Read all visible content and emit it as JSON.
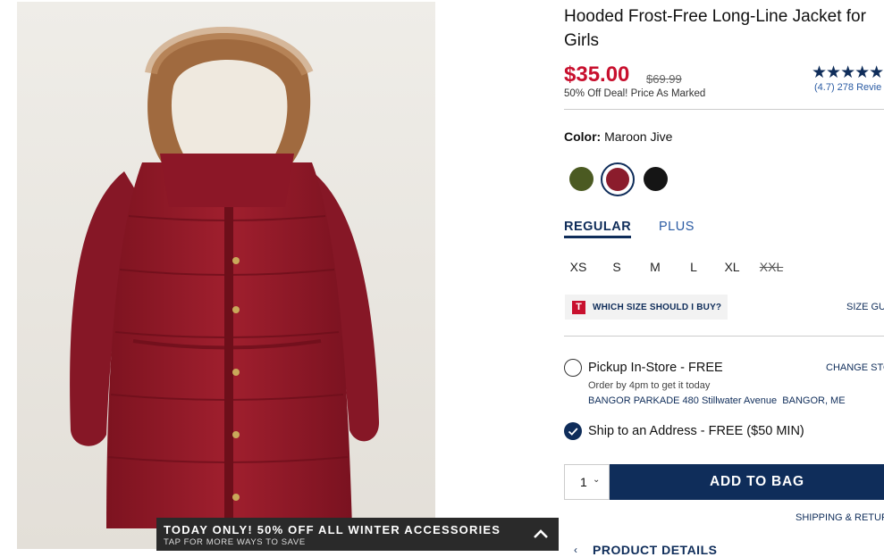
{
  "product": {
    "title": "Hooded Frost-Free Long-Line Jacket for Girls",
    "price": "$35.00",
    "original_price": "$69.99",
    "deal_text": "50% Off Deal! Price As Marked",
    "rating_stars": "★★★★★",
    "rating_text": "(4.7) 278 Revie",
    "image_icon": "jacket-photo"
  },
  "color": {
    "label": "Color:",
    "selected": "Maroon Jive",
    "swatches": [
      "#4b5a22",
      "#8b1c2c",
      "#151515"
    ]
  },
  "fit_tabs": [
    "REGULAR",
    "PLUS"
  ],
  "sizes": [
    "XS",
    "S",
    "M",
    "L",
    "XL",
    "XXL"
  ],
  "fit_helper": {
    "icon_letter": "T",
    "text": "WHICH SIZE SHOULD I BUY?",
    "guide_link": "SIZE GU"
  },
  "fulfillment": {
    "pickup_label": "Pickup In-Store - FREE",
    "change_store": "CHANGE STO",
    "order_by": "Order by 4pm to get it today",
    "store_name": "BANGOR PARKADE 480 Stillwater Avenue",
    "store_city": "BANGOR, ME",
    "ship_label": "Ship to an Address - FREE ($50 MIN)"
  },
  "cart": {
    "quantity": "1",
    "add_label": "ADD TO BAG",
    "shipping_link": "SHIPPING & RETUR"
  },
  "product_details_label": "PRODUCT DETAILS",
  "promo": {
    "headline": "TODAY ONLY! 50% OFF ALL WINTER ACCESSORIES",
    "sub": "TAP FOR MORE WAYS TO SAVE"
  },
  "colors": {
    "navy": "#0f2d5a",
    "sale_red": "#c8102e",
    "link_blue": "#2a5ba3"
  }
}
